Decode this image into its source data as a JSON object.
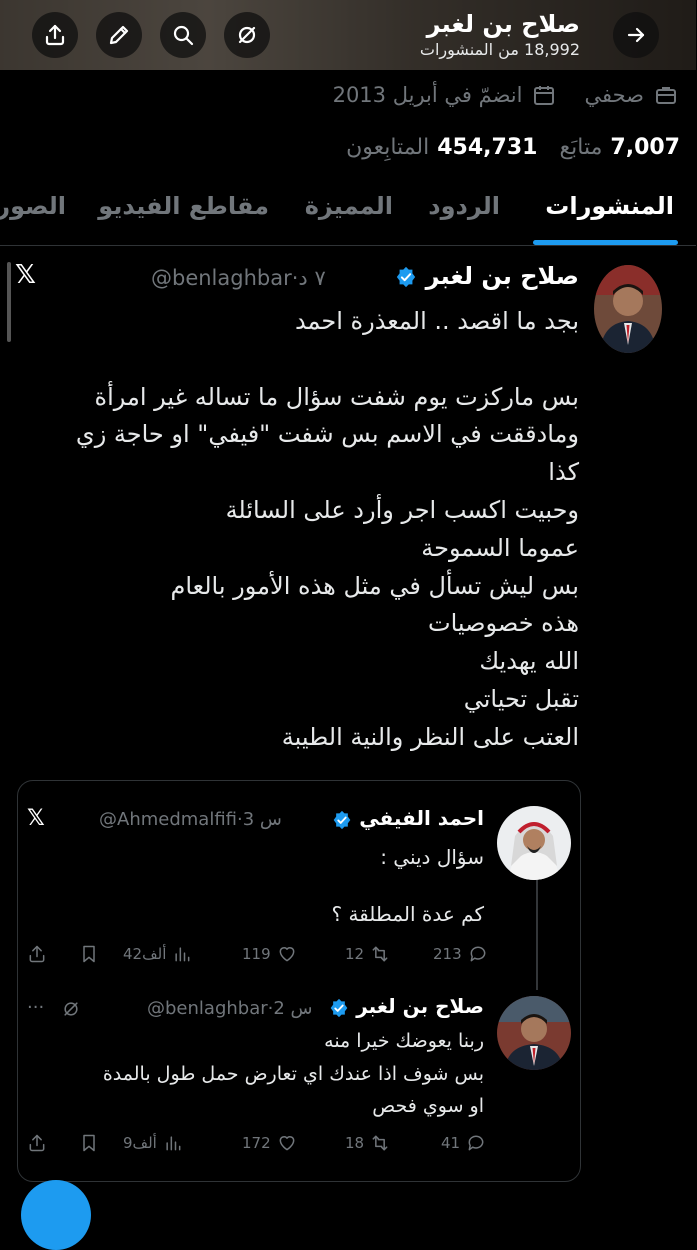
{
  "header": {
    "name": "صلاح بن لغبر",
    "posts_count": "18,992 من المنشورات",
    "buttons": [
      "share-icon",
      "edit-icon",
      "search-icon",
      "more-icon",
      "back-arrow-icon"
    ]
  },
  "profile": {
    "category": "صحفي",
    "joined": "انضمّ في أبريل 2013",
    "following_count": "7,007",
    "following_label": "متابَع",
    "followers_count": "454,731",
    "followers_label": "المتابِعون"
  },
  "tabs": [
    {
      "label": "المنشورات",
      "active": true
    },
    {
      "label": "الردود",
      "active": false
    },
    {
      "label": "المميزة",
      "active": false
    },
    {
      "label": "مقاطع الفيديو",
      "active": false
    },
    {
      "label": "الصور",
      "active": false
    }
  ],
  "tweet": {
    "name": "صلاح بن لغبر",
    "handle": "@benlaghbar·٧ د",
    "text": "بجد ما اقصد .. المعذرة احمد\n\nبس ماركزت يوم شفت سؤال ما تساله غير امرأة\nومادققت في الاسم بس شفت \"فيفي\" او حاجة زي\nكذا\nوحبيت اكسب اجر وأرد على السائلة\nعموما السموحة\nبس ليش تسأل في مثل هذه الأمور بالعام\nهذه خصوصيات\nالله يهديك\nتقبل تحياتي\nالعتب على النظر والنية الطيبة"
  },
  "quoted": {
    "name": "احمد الفيفي",
    "handle": "@Ahmedmalfifi·3 س",
    "line1": "سؤال ديني :",
    "line2": "كم عدة المطلقة ؟",
    "stats": {
      "replies": "213",
      "reposts": "12",
      "likes": "119",
      "views": "42ألف"
    }
  },
  "reply": {
    "name": "صلاح بن لغبر",
    "handle": "@benlaghbar·2 س",
    "line1": "ربنا يعوضك خيرا منه",
    "line2": "بس شوف اذا عندك اي تعارض حمل طول بالمدة",
    "line3": "او سوي فحص",
    "stats": {
      "replies": "41",
      "reposts": "18",
      "likes": "172",
      "views": "9ألف"
    }
  },
  "colors": {
    "accent": "#1d9bf0",
    "background": "#000000",
    "muted": "#71767b"
  }
}
